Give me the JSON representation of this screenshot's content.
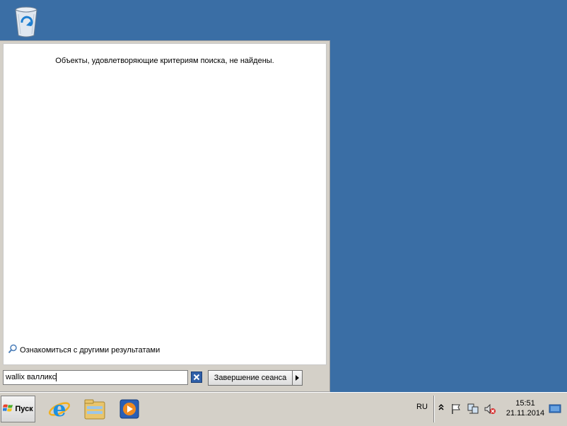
{
  "desktop": {
    "icons": [
      {
        "name": "recycle-bin-icon"
      }
    ]
  },
  "start_menu": {
    "no_results_text": "Объекты, удовлетворяющие критериям поиска, не найдены.",
    "more_results_label": "Ознакомиться с другими результатами",
    "search": {
      "value": "wallix валликс"
    },
    "logoff_label": "Завершение сеанса"
  },
  "taskbar": {
    "start_label": "Пуск",
    "pinned": [
      "internet-explorer-icon",
      "file-explorer-icon",
      "media-player-icon"
    ],
    "tray": {
      "language": "RU",
      "time": "15:51",
      "date": "21.11.2014"
    }
  },
  "colors": {
    "desktop_bg": "#3a6ea5",
    "panel_bg": "#d4d0c8",
    "accent": "#2f5fa8"
  }
}
